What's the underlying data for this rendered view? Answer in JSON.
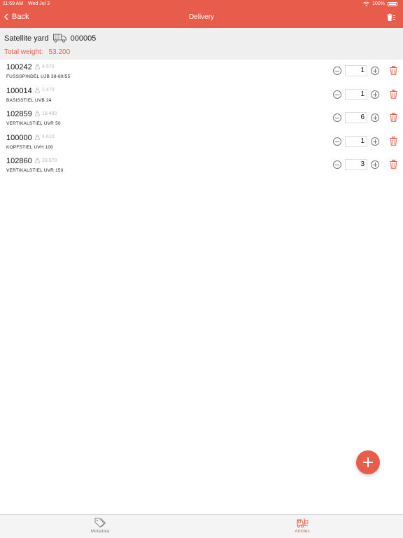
{
  "status_bar": {
    "time": "11:59 AM",
    "date": "Wed Jul 3",
    "battery": "100%"
  },
  "nav": {
    "back_label": "Back",
    "title": "Delivery"
  },
  "header": {
    "location": "Satellite yard",
    "delivery_number": "000005",
    "total_weight_label": "Total weight:",
    "total_weight_value": "53.200"
  },
  "items": [
    {
      "number": "100242",
      "weight": "4.570",
      "description": "FUSSSPINDEL UJB 38-80/55",
      "quantity": "1"
    },
    {
      "number": "100014",
      "weight": "2.470",
      "description": "BASISSTIEL UVB 24",
      "quantity": "1"
    },
    {
      "number": "102859",
      "weight": "18.480",
      "description": "VERTIKALSTIEL UVR  50",
      "quantity": "6"
    },
    {
      "number": "100000",
      "weight": "4.610",
      "description": "KOPFSTIEL UVH 100",
      "quantity": "1"
    },
    {
      "number": "102860",
      "weight": "23.070",
      "description": "VERTIKALSTIEL UVR 150",
      "quantity": "3"
    }
  ],
  "tabs": [
    {
      "label": "Metadata",
      "icon": "tags-icon",
      "active": false
    },
    {
      "label": "Articles",
      "icon": "forklift-icon",
      "active": true
    }
  ],
  "colors": {
    "accent": "#e85c4c",
    "header_bg": "#efefef",
    "tabbar_bg": "#f4f4f4"
  }
}
